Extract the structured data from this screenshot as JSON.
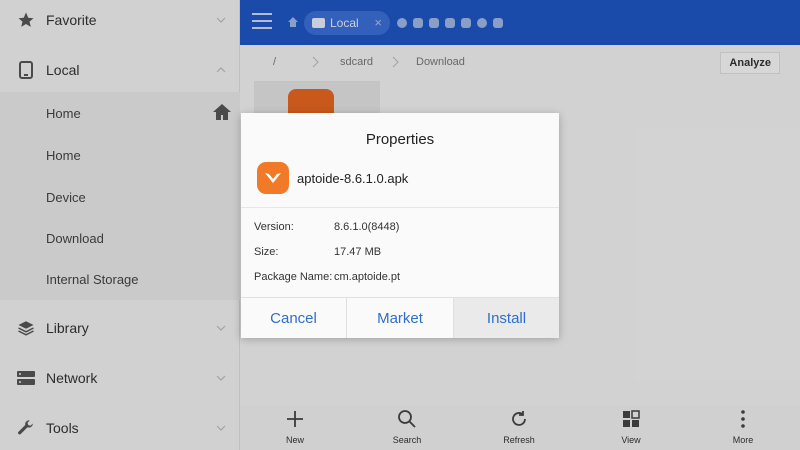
{
  "sidebar": {
    "sections": [
      {
        "label": "Favorite",
        "icon": "star-icon"
      },
      {
        "label": "Local",
        "icon": "phone-icon"
      },
      {
        "label": "Library",
        "icon": "layers-icon"
      },
      {
        "label": "Network",
        "icon": "network-icon"
      },
      {
        "label": "Tools",
        "icon": "wrench-icon"
      }
    ],
    "local_items": [
      {
        "label": "Home"
      },
      {
        "label": "Home"
      },
      {
        "label": "Device"
      },
      {
        "label": "Download"
      },
      {
        "label": "Internal Storage"
      }
    ]
  },
  "header": {
    "tab_label": "Local",
    "tab_close": "×",
    "accent": "#1e55c4"
  },
  "pathbar": {
    "crumbs": [
      "/",
      "sdcard",
      "Download"
    ],
    "analyze_label": "Analyze"
  },
  "dialog": {
    "title": "Properties",
    "file_name": "aptoide-8.6.1.0.apk",
    "props": [
      {
        "label": "Version:",
        "value": "8.6.1.0(8448)"
      },
      {
        "label": "Size:",
        "value": "17.47 MB"
      },
      {
        "label": "Package Name:",
        "value": "cm.aptoide.pt"
      }
    ],
    "buttons": {
      "cancel": "Cancel",
      "market": "Market",
      "install": "Install"
    },
    "button_color": "#2f6fc9"
  },
  "toolbar": [
    {
      "label": "New",
      "icon": "plus-icon"
    },
    {
      "label": "Search",
      "icon": "search-icon"
    },
    {
      "label": "Refresh",
      "icon": "refresh-icon"
    },
    {
      "label": "View",
      "icon": "grid-view-icon"
    },
    {
      "label": "More",
      "icon": "more-vert-icon"
    }
  ]
}
